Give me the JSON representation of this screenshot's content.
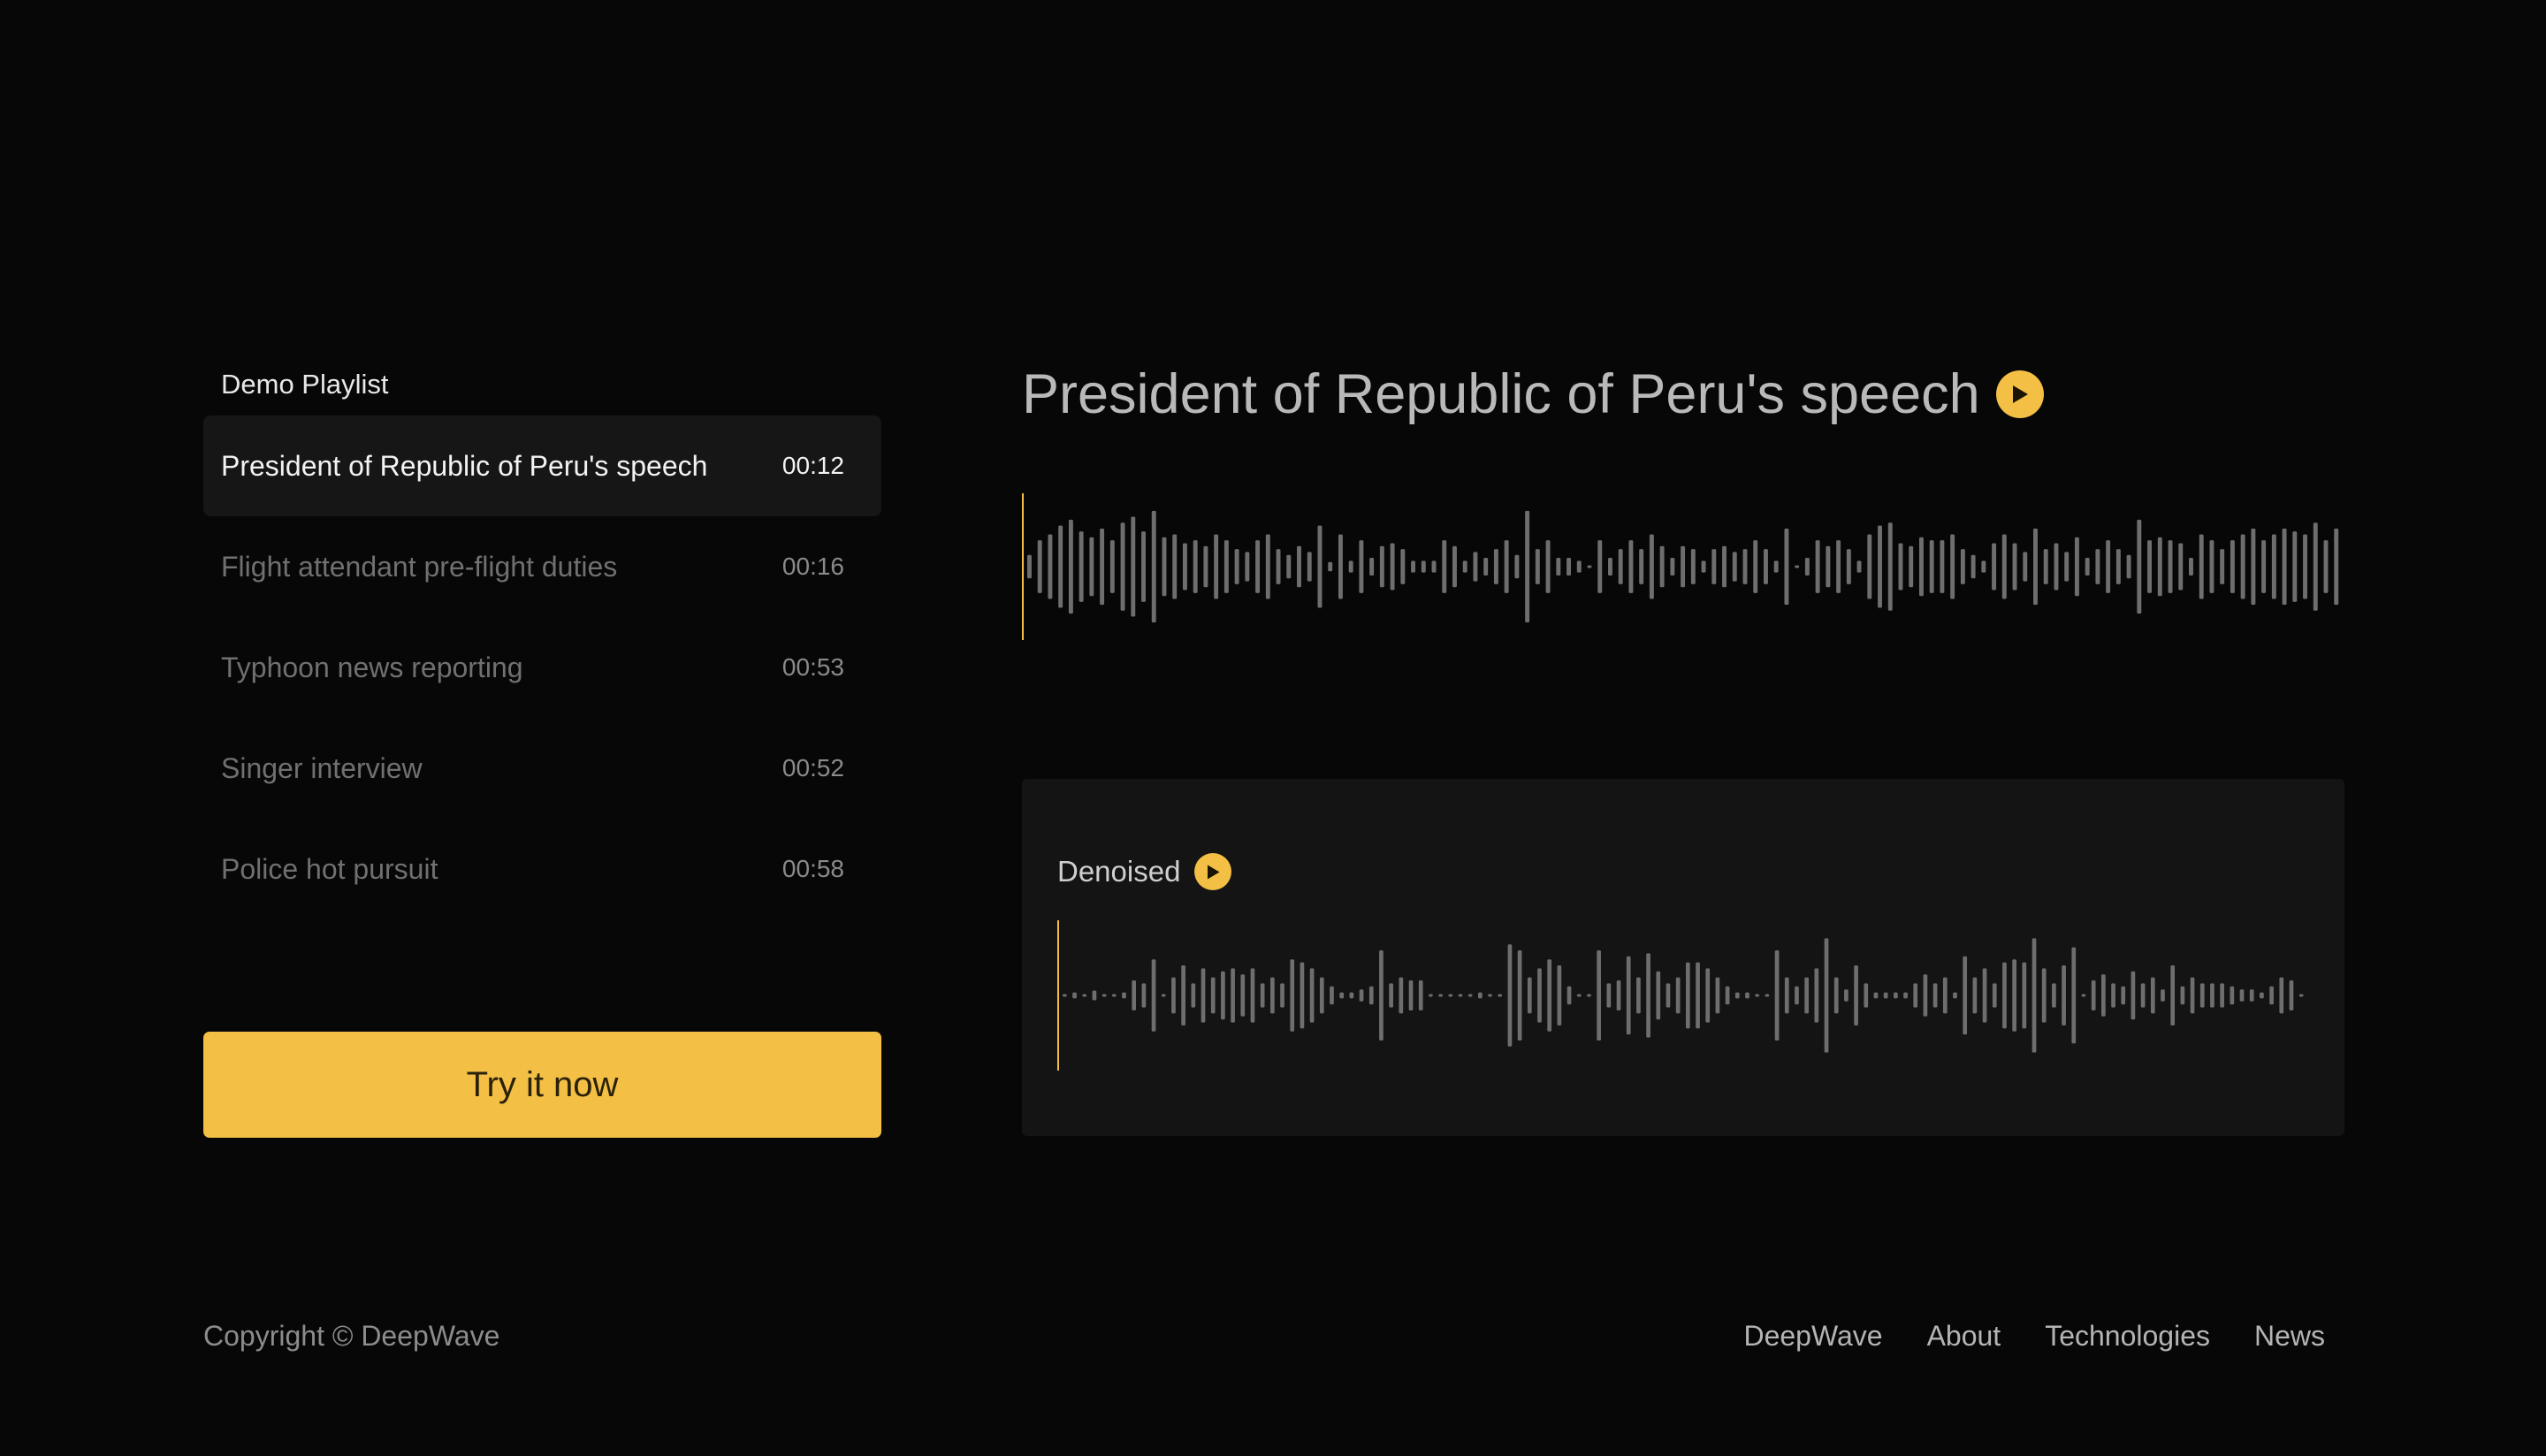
{
  "colors": {
    "background": "#070707",
    "accent": "#f3bf45",
    "active_row": "#161616",
    "card": "#141414",
    "waveform_bar": "#6e6e6e",
    "playhead": "#f3bf45"
  },
  "playlist": {
    "title": "Demo Playlist",
    "items": [
      {
        "title": "President of Republic of Peru's speech",
        "duration": "00:12",
        "active": true
      },
      {
        "title": "Flight attendant pre-flight duties",
        "duration": "00:16",
        "active": false
      },
      {
        "title": "Typhoon news reporting",
        "duration": "00:53",
        "active": false
      },
      {
        "title": "Singer interview",
        "duration": "00:52",
        "active": false
      },
      {
        "title": "Police hot pursuit",
        "duration": "00:58",
        "active": false
      }
    ]
  },
  "cta": {
    "label": "Try it now"
  },
  "player": {
    "track_title": "President of Republic of Peru's speech",
    "play_icon": "play-circle-icon",
    "playback_progress": 0,
    "original_waveform": [
      0.2,
      0.45,
      0.55,
      0.7,
      0.8,
      0.6,
      0.5,
      0.65,
      0.45,
      0.75,
      0.85,
      0.6,
      0.95,
      0.5,
      0.55,
      0.4,
      0.45,
      0.35,
      0.55,
      0.45,
      0.3,
      0.25,
      0.45,
      0.55,
      0.3,
      0.2,
      0.35,
      0.25,
      0.7,
      0.08,
      0.55,
      0.1,
      0.45,
      0.15,
      0.35,
      0.4,
      0.3,
      0.1,
      0.1,
      0.1,
      0.45,
      0.35,
      0.1,
      0.25,
      0.15,
      0.3,
      0.45,
      0.2,
      0.95,
      0.3,
      0.45,
      0.15,
      0.15,
      0.1,
      0.02,
      0.45,
      0.15,
      0.3,
      0.45,
      0.3,
      0.55,
      0.35,
      0.15,
      0.35,
      0.3,
      0.1,
      0.3,
      0.35,
      0.25,
      0.3,
      0.45,
      0.3,
      0.1,
      0.65,
      0.02,
      0.15,
      0.45,
      0.35,
      0.45,
      0.3,
      0.1,
      0.55,
      0.7,
      0.75,
      0.4,
      0.35,
      0.5,
      0.45,
      0.45,
      0.55,
      0.3,
      0.2,
      0.1,
      0.4,
      0.55,
      0.4,
      0.25,
      0.65,
      0.3,
      0.4,
      0.25,
      0.5,
      0.15,
      0.3,
      0.45,
      0.3,
      0.2,
      0.8,
      0.45,
      0.5,
      0.45,
      0.4,
      0.15,
      0.55,
      0.45,
      0.3,
      0.45,
      0.55,
      0.65,
      0.45,
      0.55,
      0.65,
      0.6,
      0.55,
      0.75,
      0.45,
      0.65
    ]
  },
  "denoised": {
    "label": "Denoised",
    "play_icon": "play-circle-icon",
    "playback_progress": 0,
    "waveform": [
      0.02,
      0.05,
      0.02,
      0.08,
      0.02,
      0.02,
      0.05,
      0.25,
      0.2,
      0.6,
      0.02,
      0.3,
      0.5,
      0.2,
      0.45,
      0.3,
      0.4,
      0.45,
      0.35,
      0.45,
      0.2,
      0.3,
      0.2,
      0.6,
      0.55,
      0.45,
      0.3,
      0.15,
      0.05,
      0.05,
      0.1,
      0.15,
      0.75,
      0.2,
      0.3,
      0.25,
      0.25,
      0.02,
      0.02,
      0.02,
      0.02,
      0.02,
      0.05,
      0.02,
      0.02,
      0.85,
      0.75,
      0.3,
      0.45,
      0.6,
      0.5,
      0.15,
      0.02,
      0.02,
      0.75,
      0.2,
      0.25,
      0.65,
      0.3,
      0.7,
      0.4,
      0.2,
      0.3,
      0.55,
      0.55,
      0.45,
      0.3,
      0.15,
      0.05,
      0.05,
      0.02,
      0.02,
      0.75,
      0.3,
      0.15,
      0.3,
      0.45,
      0.95,
      0.3,
      0.1,
      0.5,
      0.2,
      0.05,
      0.05,
      0.05,
      0.05,
      0.2,
      0.35,
      0.2,
      0.3,
      0.05,
      0.65,
      0.3,
      0.45,
      0.2,
      0.55,
      0.6,
      0.55,
      0.95,
      0.45,
      0.2,
      0.5,
      0.8,
      0.02,
      0.25,
      0.35,
      0.2,
      0.15,
      0.4,
      0.2,
      0.3,
      0.1,
      0.5,
      0.15,
      0.3,
      0.2,
      0.2,
      0.2,
      0.15,
      0.1,
      0.1,
      0.05,
      0.15,
      0.3,
      0.25,
      0.02
    ]
  },
  "footer": {
    "copyright": "Copyright © DeepWave",
    "links": [
      "DeepWave",
      "About",
      "Technologies",
      "News"
    ]
  }
}
